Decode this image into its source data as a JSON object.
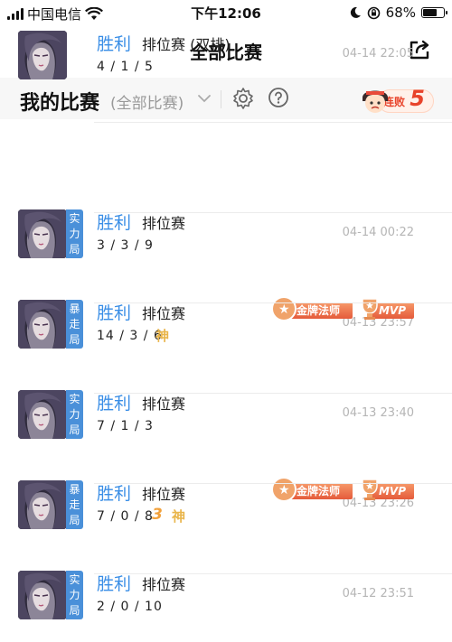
{
  "status_bar": {
    "carrier": "中国电信",
    "time": "下午12:06",
    "battery": "68%",
    "battery_level": 0.68
  },
  "nav": {
    "title": "全部比赛"
  },
  "section": {
    "title": "我的比赛",
    "filter": "(全部比赛)",
    "streak_label": "连败",
    "streak_count": "5"
  },
  "matches": [
    {
      "result": "胜利",
      "mode": "排位赛 (双排)",
      "kda": "4 / 1 / 5",
      "time": "04-14 22:05",
      "tag": "",
      "gold_badge": "",
      "mvp_badge": "",
      "god": "",
      "triple": ""
    },
    {
      "result": "胜利",
      "mode": "排位赛",
      "kda": "3 / 3 / 9",
      "time": "04-14 00:22",
      "tag": "实力局",
      "gold_badge": "",
      "mvp_badge": "",
      "god": "",
      "triple": ""
    },
    {
      "result": "胜利",
      "mode": "排位赛",
      "kda": "14 / 3 / 6",
      "time": "04-13 23:57",
      "tag": "暴走局",
      "gold_badge": "金牌法师",
      "mvp_badge": "MVP",
      "god": "神",
      "triple": ""
    },
    {
      "result": "胜利",
      "mode": "排位赛",
      "kda": "7 / 1 / 3",
      "time": "04-13 23:40",
      "tag": "实力局",
      "gold_badge": "",
      "mvp_badge": "",
      "god": "",
      "triple": ""
    },
    {
      "result": "胜利",
      "mode": "排位赛",
      "kda": "7 / 0 / 8",
      "time": "04-13 23:26",
      "tag": "暴走局",
      "gold_badge": "金牌法师",
      "mvp_badge": "MVP",
      "god": "神",
      "triple": "3"
    },
    {
      "result": "胜利",
      "mode": "排位赛",
      "kda": "2 / 0 / 10",
      "time": "04-12 23:51",
      "tag": "实力局",
      "gold_badge": "",
      "mvp_badge": "",
      "god": "",
      "triple": ""
    }
  ],
  "colors": {
    "win": "#3a8ee6",
    "tag": "#4a90d9",
    "badge": "#e55b3b",
    "streak": "#e8432a"
  }
}
